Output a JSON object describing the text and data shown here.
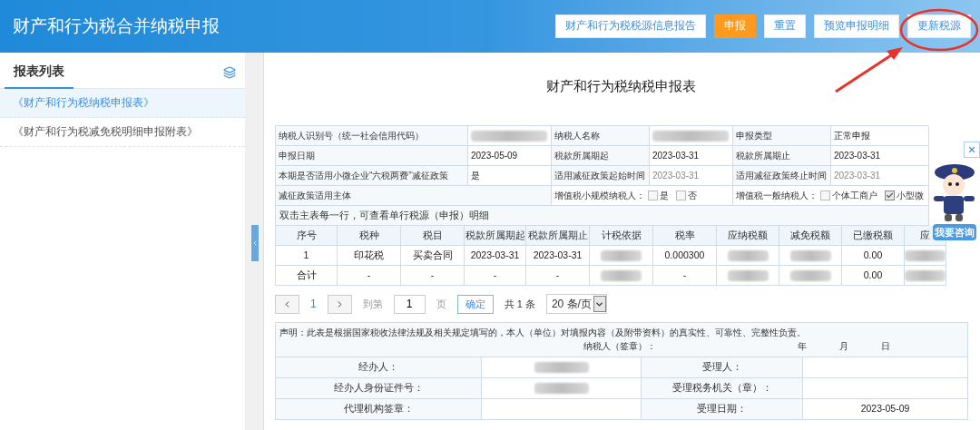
{
  "header": {
    "title": "财产和行为税合并纳税申报",
    "buttons": [
      {
        "label": "财产和行为税税源信息报告",
        "kind": "default"
      },
      {
        "label": "申报",
        "kind": "primary"
      },
      {
        "label": "重置",
        "kind": "default"
      },
      {
        "label": "预览申报明细",
        "kind": "default"
      },
      {
        "label": "更新税源",
        "kind": "default"
      }
    ]
  },
  "sidebar": {
    "heading": "报表列表",
    "items": [
      {
        "label": "《财产和行为税纳税申报表》",
        "selected": true
      },
      {
        "label": "《财产和行为税减免税明细申报附表》",
        "selected": false
      }
    ]
  },
  "form": {
    "title": "财产和行为税纳税申报表",
    "info_rows": [
      {
        "kind": "fields",
        "cells": [
          {
            "kind": "label",
            "text": "纳税人识别号（统一社会信用代码）"
          },
          {
            "kind": "redacted"
          },
          {
            "kind": "label",
            "text": "纳税人名称"
          },
          {
            "kind": "redacted"
          },
          {
            "kind": "label",
            "text": "申报类型"
          },
          {
            "kind": "value",
            "text": "正常申报"
          }
        ]
      },
      {
        "kind": "fields",
        "cells": [
          {
            "kind": "label",
            "text": "申报日期"
          },
          {
            "kind": "value",
            "text": "2023-05-09"
          },
          {
            "kind": "label",
            "text": "税款所属期起"
          },
          {
            "kind": "value",
            "text": "2023-03-31"
          },
          {
            "kind": "label",
            "text": "税款所属期止"
          },
          {
            "kind": "value",
            "text": "2023-03-31"
          }
        ]
      },
      {
        "kind": "fields",
        "cells": [
          {
            "kind": "label",
            "text": "本期是否适用小微企业“六税两费”减征政策"
          },
          {
            "kind": "value",
            "text": "是"
          },
          {
            "kind": "label",
            "text": "适用减征政策起始时间"
          },
          {
            "kind": "muted",
            "text": "2023-03-31"
          },
          {
            "kind": "label",
            "text": "适用减征政策终止时间"
          },
          {
            "kind": "muted",
            "text": "2023-03-31"
          }
        ]
      },
      {
        "kind": "subject",
        "label": "减征政策适用主体",
        "groups": [
          {
            "label": "增值税小规模纳税人：",
            "options": [
              {
                "label": "是",
                "checked": false
              },
              {
                "label": "否",
                "checked": false
              }
            ]
          },
          {
            "label": "增值税一般纳税人：",
            "options": [
              {
                "label": "个体工商户",
                "checked": false
              },
              {
                "label": "小型微",
                "checked": true
              }
            ]
          }
        ]
      },
      {
        "kind": "hint",
        "text": "双击主表每一行，可查看单行税源（申报）明细"
      }
    ],
    "table": {
      "columns": [
        "序号",
        "税种",
        "税目",
        "税款所属期起",
        "税款所属期止",
        "计税依据",
        "税率",
        "应纳税额",
        "减免税额",
        "已缴税额",
        "应"
      ],
      "rows": [
        {
          "cells": [
            {
              "kind": "text",
              "text": "1"
            },
            {
              "kind": "text",
              "text": "印花税"
            },
            {
              "kind": "text",
              "text": "买卖合同"
            },
            {
              "kind": "text",
              "text": "2023-03-31"
            },
            {
              "kind": "text",
              "text": "2023-03-31"
            },
            {
              "kind": "redacted"
            },
            {
              "kind": "text",
              "text": "0.000300"
            },
            {
              "kind": "redacted"
            },
            {
              "kind": "redacted"
            },
            {
              "kind": "text",
              "text": "0.00"
            },
            {
              "kind": "redacted"
            }
          ]
        },
        {
          "cells": [
            {
              "kind": "text",
              "text": "合计"
            },
            {
              "kind": "text",
              "text": "-"
            },
            {
              "kind": "text",
              "text": "-"
            },
            {
              "kind": "text",
              "text": "-"
            },
            {
              "kind": "text",
              "text": "-"
            },
            {
              "kind": "redacted"
            },
            {
              "kind": "text",
              "text": "-"
            },
            {
              "kind": "redacted"
            },
            {
              "kind": "redacted"
            },
            {
              "kind": "text",
              "text": "0.00"
            },
            {
              "kind": "redacted"
            }
          ]
        }
      ]
    },
    "pagination": {
      "current_page": "1",
      "goto_label": "到第",
      "goto_value": "1",
      "page_unit": "页",
      "confirm": "确定",
      "total": "共 1 条",
      "page_size": "20 条/页"
    },
    "declaration": {
      "statement": "声明：此表是根据国家税收法律法规及相关规定填写的，本人（单位）对填报内容（及附带资料）的真实性、可靠性、完整性负责。",
      "signature": "纳税人（签章）：",
      "year": "年",
      "month": "月",
      "day": "日",
      "rows": [
        {
          "cells": [
            {
              "kind": "label",
              "text": "经办人："
            },
            {
              "kind": "redacted"
            },
            {
              "kind": "label",
              "text": "受理人："
            },
            {
              "kind": "empty"
            }
          ]
        },
        {
          "cells": [
            {
              "kind": "label",
              "text": "经办人身份证件号："
            },
            {
              "kind": "redacted"
            },
            {
              "kind": "label",
              "text": "受理税务机关（章）："
            },
            {
              "kind": "empty"
            }
          ]
        },
        {
          "cells": [
            {
              "kind": "label",
              "text": "代理机构签章："
            },
            {
              "kind": "empty"
            },
            {
              "kind": "label",
              "text": "受理日期："
            },
            {
              "kind": "value",
              "text": "2023-05-09"
            }
          ]
        }
      ]
    }
  },
  "assistant": {
    "button": "我要咨询"
  }
}
